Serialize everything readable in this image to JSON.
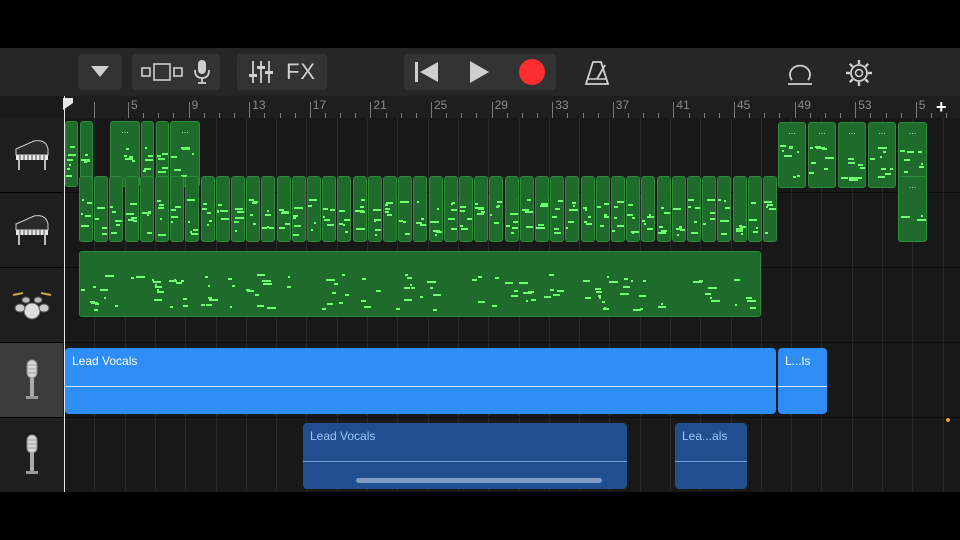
{
  "toolbar": {
    "icons": [
      "track-menu-icon",
      "track-view-icon",
      "microphone-icon",
      "mixer-icon",
      "fx-label",
      "rewind-icon",
      "play-icon",
      "record-icon",
      "metronome-icon",
      "loop-browser-icon",
      "settings-icon"
    ],
    "fx_label": "FX",
    "colors": {
      "record": "#ff2d2d",
      "icon": "#cfcfcf"
    }
  },
  "ruler": {
    "bars": [
      "5",
      "9",
      "13",
      "17",
      "21",
      "25",
      "29",
      "33",
      "37",
      "41",
      "45",
      "49",
      "53",
      "5"
    ],
    "add_label": "+"
  },
  "tracks": [
    {
      "instrument": "grand-piano-icon",
      "kind": "midi"
    },
    {
      "instrument": "grand-piano-icon",
      "kind": "midi"
    },
    {
      "instrument": "drum-kit-icon",
      "kind": "midi"
    },
    {
      "instrument": "microphone-icon",
      "kind": "audio",
      "selected": true
    },
    {
      "instrument": "microphone-icon",
      "kind": "audio"
    }
  ],
  "regions": {
    "vocals_main": "Lead Vocals",
    "vocals_main_short": "L...ls",
    "vocals_second": "Lead Vocals",
    "vocals_second_short": "Lea...als",
    "region_dots": "..."
  },
  "colors": {
    "midi_region": "#1f6b2b",
    "midi_note": "#6dff6d",
    "audio_selected": "#2e8df7",
    "audio_unselected": "#1f4f8f"
  }
}
